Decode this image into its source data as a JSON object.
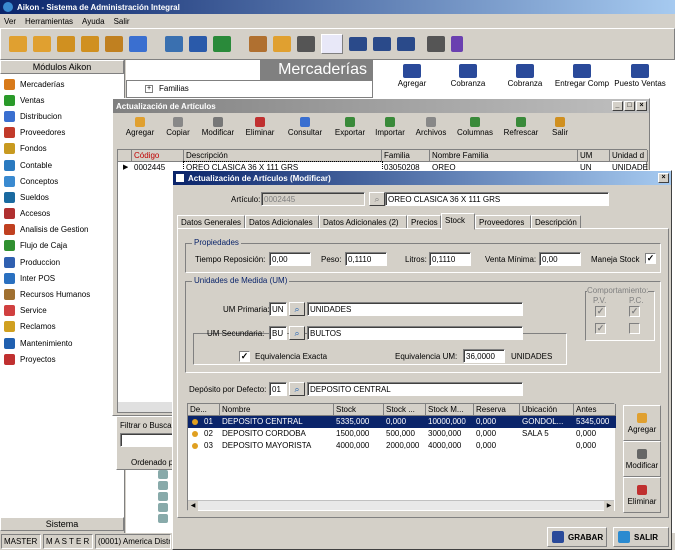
{
  "app": {
    "title": "Aikon - Sistema de Administración Integral",
    "menu": [
      "Ver",
      "Herramientas",
      "Ayuda",
      "Salir"
    ]
  },
  "sidebar": {
    "header": "Módulos Aikon",
    "footer": "Sistema",
    "items": [
      {
        "label": "Mercaderías",
        "color": "#d87a1a"
      },
      {
        "label": "Ventas",
        "color": "#2a9a2a"
      },
      {
        "label": "Distribucion",
        "color": "#3a6fd0"
      },
      {
        "label": "Proveedores",
        "color": "#c23a2a"
      },
      {
        "label": "Fondos",
        "color": "#c89a20"
      },
      {
        "label": "Contable",
        "color": "#2a7ac0"
      },
      {
        "label": "Conceptos",
        "color": "#3a8ad0"
      },
      {
        "label": "Sueldos",
        "color": "#1a6aa0"
      },
      {
        "label": "Accesos",
        "color": "#b03030"
      },
      {
        "label": "Analisis de Gestion",
        "color": "#c04020"
      },
      {
        "label": "Flujo de Caja",
        "color": "#309030"
      },
      {
        "label": "Produccion",
        "color": "#3060b0"
      },
      {
        "label": "Inter POS",
        "color": "#2a70c0"
      },
      {
        "label": "Recursos Humanos",
        "color": "#a07030"
      },
      {
        "label": "Service",
        "color": "#d04040"
      },
      {
        "label": "Reclamos",
        "color": "#d0a020"
      },
      {
        "label": "Mantenimiento",
        "color": "#2060b0"
      },
      {
        "label": "Proyectos",
        "color": "#c03030"
      }
    ]
  },
  "status": {
    "user": "MASTER",
    "user2": "M A S T E R",
    "company": "(0001) America Distri"
  },
  "bg": {
    "header": "Mercaderías",
    "tree_root": "Familias",
    "quick": [
      "Agregar",
      "Cobranza",
      "Cobranza",
      "Entregar Comp",
      "Puesto Ventas"
    ],
    "filter_label": "Filtrar o Buscar",
    "ordenado": "Ordenado po"
  },
  "listwin": {
    "title": "Actualización de Artículos",
    "toolbar": [
      "Agregar",
      "Copiar",
      "Modificar",
      "Eliminar",
      "Consultar",
      "Exportar",
      "Importar",
      "Archivos",
      "Columnas",
      "Refrescar",
      "Salir"
    ],
    "columns": [
      "Código",
      "Descripción",
      "Familia",
      "Nombre Familia",
      "UM",
      "Unidad d"
    ],
    "row": [
      "0002445",
      "OREO CLASICA 36 X 111 GRS",
      "03050208",
      "OREO",
      "UN",
      "UNIDADE"
    ]
  },
  "dialog": {
    "title": "Actualización de Artículos (Modificar)",
    "articulo_label": "Artículo:",
    "articulo_code": "0002445",
    "articulo_desc": "OREO CLASICA 36 X 111 GRS",
    "tabs": [
      "Datos Generales",
      "Datos Adicionales",
      "Datos Adicionales (2)",
      "Precios",
      "Stock",
      "Proveedores",
      "Descripción"
    ],
    "props": {
      "title": "Propiedades",
      "tiempo_label": "Tiempo Reposición:",
      "tiempo": "0,00",
      "peso_label": "Peso:",
      "peso": "0,1110",
      "litros_label": "Litros:",
      "litros": "0,1110",
      "venta_label": "Venta Mínima:",
      "venta": "0,00",
      "maneja_label": "Maneja Stock"
    },
    "um": {
      "title": "Unidades de Medida (UM)",
      "prim_label": "UM Primaria:",
      "prim_code": "UN",
      "prim_desc": "UNIDADES",
      "sec_label": "UM Secundaria:",
      "sec_code": "BU",
      "sec_desc": "BULTOS",
      "equiv_label": "Equivalencia Exacta",
      "equiv_um_label": "Equivalencia UM:",
      "equiv_um": "36,0000",
      "equiv_unit": "UNIDADES",
      "comp_title": "Comportamiento:",
      "pv": "P.V.",
      "pc": "P.C."
    },
    "deposito": {
      "label": "Depósito por Defecto:",
      "code": "01",
      "desc": "DEPOSITO CENTRAL"
    },
    "grid": {
      "columns": [
        "De...",
        "Nombre",
        "Stock",
        "Stock ...",
        "Stock M...",
        "Reserva",
        "Ubicación",
        "Antes"
      ],
      "rows": [
        [
          "01",
          "DEPOSITO CENTRAL",
          "5335,000",
          "0,000",
          "10000,000",
          "0,000",
          "GONDOL...",
          "5345,000"
        ],
        [
          "02",
          "DEPOSITO CORDOBA",
          "1500,000",
          "500,000",
          "3000,000",
          "0,000",
          "SALA 5",
          "0,000"
        ],
        [
          "03",
          "DEPOSITO MAYORISTA",
          "4000,000",
          "2000,000",
          "4000,000",
          "0,000",
          "",
          "0,000"
        ]
      ]
    },
    "side_buttons": [
      "Agregar",
      "Modificar",
      "Eliminar"
    ],
    "grabar": "GRABAR",
    "salir": "SALIR"
  }
}
